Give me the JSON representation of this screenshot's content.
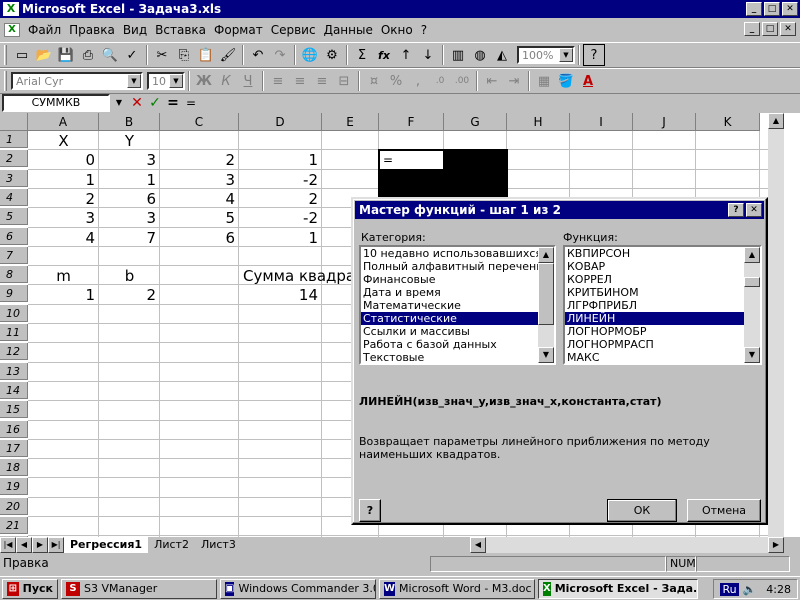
{
  "window": {
    "title": "Microsoft Excel - Задача3.xls",
    "min": "_",
    "max": "□",
    "close": "✕"
  },
  "menu": [
    "Файл",
    "Правка",
    "Вид",
    "Вставка",
    "Формат",
    "Сервис",
    "Данные",
    "Окно",
    "?"
  ],
  "toolbar": {
    "zoom": "100%",
    "font": "Arial Cyr",
    "size": "10",
    "bold": "Ж",
    "italic": "К",
    "underline": "Ч",
    "percent": "%",
    "comma": ",",
    "sigma": "Σ",
    "fx": "fx"
  },
  "formula_bar": {
    "name_box": "СУММКВ",
    "cancel": "✕",
    "enter": "✓",
    "equals": "=",
    "content": "="
  },
  "columns": [
    "A",
    "B",
    "C",
    "D",
    "E",
    "F",
    "G",
    "H",
    "I",
    "J",
    "K"
  ],
  "rows": [
    "1",
    "2",
    "3",
    "4",
    "5",
    "6",
    "7",
    "8",
    "9",
    "10",
    "11",
    "12",
    "13",
    "14",
    "15",
    "16",
    "17",
    "18",
    "19",
    "20",
    "21",
    "22"
  ],
  "cells": {
    "A1": "X",
    "B1": "Y",
    "A2": "0",
    "B2": "3",
    "C2": "2",
    "D2": "1",
    "A3": "1",
    "B3": "1",
    "C3": "3",
    "D3": "-2",
    "A4": "2",
    "B4": "6",
    "C4": "4",
    "D4": "2",
    "A5": "3",
    "B5": "3",
    "C5": "5",
    "D5": "-2",
    "A6": "4",
    "B6": "7",
    "C6": "6",
    "D6": "1",
    "A8": "m",
    "B8": "b",
    "D8": "Сумма квадра",
    "A9": "1",
    "B9": "2",
    "D9": "14",
    "F2": "="
  },
  "sheet_tabs": [
    "Регрессия1",
    "Лист2",
    "Лист3"
  ],
  "status": {
    "text": "Правка",
    "num": "NUM"
  },
  "dialog": {
    "title": "Мастер функций - шаг 1 из 2",
    "help": "?",
    "close": "✕",
    "category_label": "Категория:",
    "function_label": "Функция:",
    "categories": [
      "10 недавно использовавшихся",
      "Полный алфавитный перечень",
      "Финансовые",
      "Дата и время",
      "Математические",
      "Статистические",
      "Ссылки и массивы",
      "Работа с базой данных",
      "Текстовые"
    ],
    "selected_category": 5,
    "functions": [
      "КВПИРСОН",
      "КОВАР",
      "КОРРЕЛ",
      "КРИТБИНОМ",
      "ЛГРФПРИБЛ",
      "ЛИНЕЙН",
      "ЛОГНОРМОБР",
      "ЛОГНОРМРАСП",
      "МАКС"
    ],
    "selected_function": 5,
    "syntax": "ЛИНЕЙН(изв_знач_y,изв_знач_x,константа,стат)",
    "description": "Возвращает параметры линейного приближения по методу наименьших квадратов.",
    "ok": "ОК",
    "cancel": "Отмена"
  },
  "taskbar": {
    "start": "Пуск",
    "items": [
      "S3 VManager",
      "Windows Commander 3.0...",
      "Microsoft Word - M3.doc",
      "Microsoft Excel - Зада..."
    ],
    "lang": "Ru",
    "clock": "4:28"
  }
}
